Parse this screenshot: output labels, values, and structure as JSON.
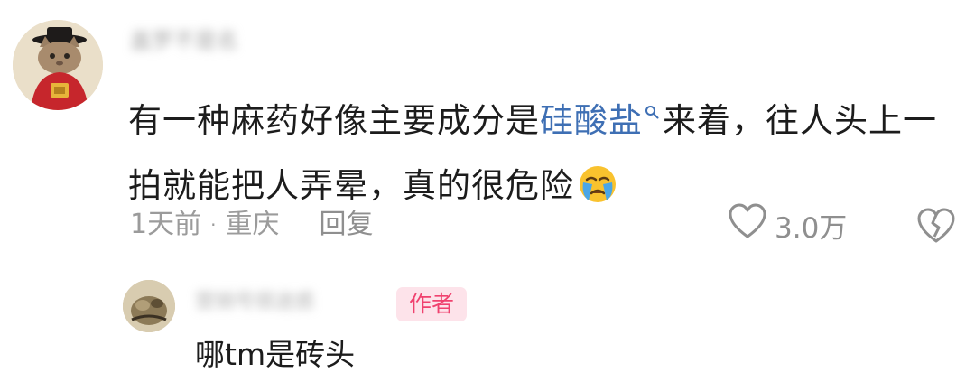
{
  "comment": {
    "username": "盖罗不是名",
    "text_before": "有一种麻药好像主要成分是",
    "keyword": "硅酸盐",
    "text_after": "来着，往人头上一拍就能把人弄晕，真的很危险",
    "emoji": "loudly-crying-face",
    "time": "1天前",
    "separator": "·",
    "location": "重庆",
    "reply_label": "回复",
    "like_count": "3.0万"
  },
  "reply": {
    "username": "营销号很迷惑",
    "badge": "作者",
    "text": "哪tm是砖头"
  },
  "colors": {
    "keyword_link": "#3e6fb4",
    "meta_gray": "#9b9b9b",
    "badge_bg": "#fde3ea",
    "badge_text": "#f0426f"
  }
}
